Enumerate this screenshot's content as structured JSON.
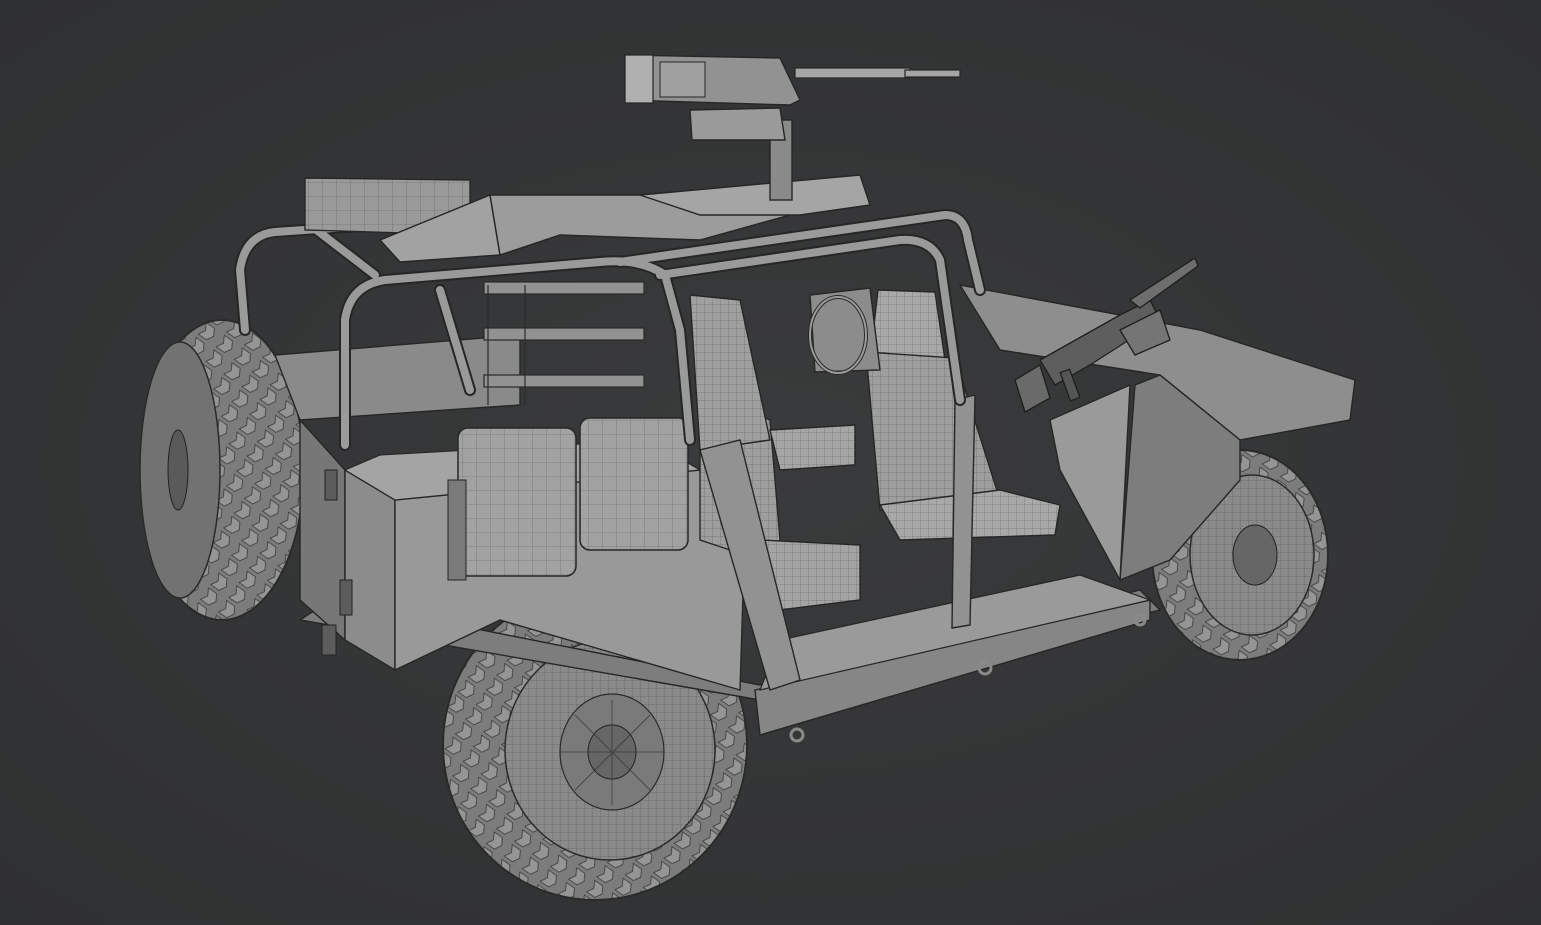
{
  "scene": {
    "subject": "vehicle-wireframe-model",
    "colors": {
      "background": "#333435",
      "body": "#8e8e8e",
      "body_light": "#a6a6a6",
      "body_dark": "#6e6e6e",
      "tire": "#7a7a7a",
      "wire": "#2b2b2b"
    }
  }
}
